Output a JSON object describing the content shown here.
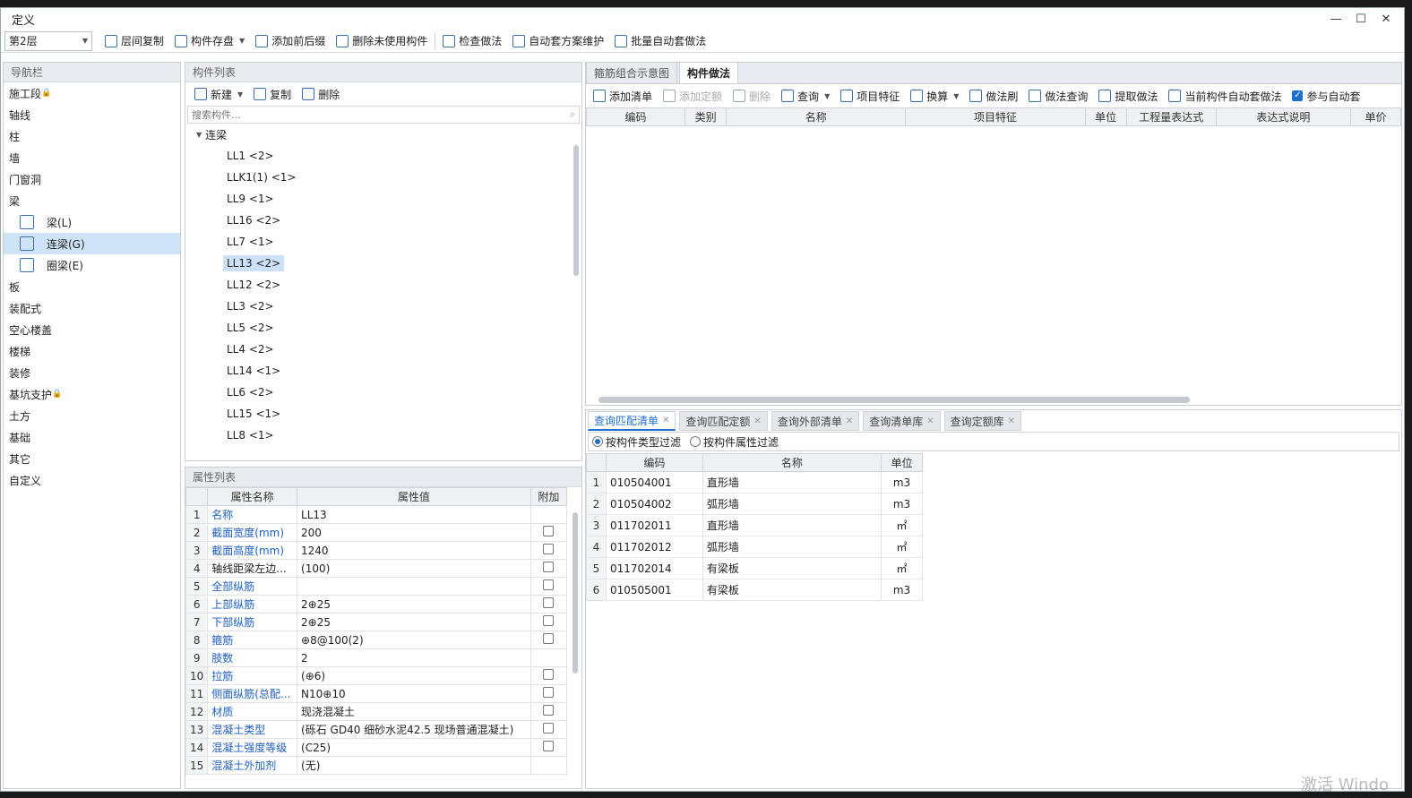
{
  "window": {
    "title": "定义"
  },
  "toolbar": {
    "floor": "第2层",
    "buttons": [
      "层间复制",
      "构件存盘",
      "添加前后缀",
      "删除未使用构件",
      "检查做法",
      "自动套方案维护",
      "批量自动套做法"
    ]
  },
  "nav": {
    "header": "导航栏",
    "items": [
      {
        "label": "施工段",
        "lock": true
      },
      {
        "label": "轴线"
      },
      {
        "label": "柱"
      },
      {
        "label": "墙"
      },
      {
        "label": "门窗洞"
      },
      {
        "label": "梁"
      },
      {
        "label": "梁(L)",
        "sub": true
      },
      {
        "label": "连梁(G)",
        "sub": true,
        "selected": true
      },
      {
        "label": "圈梁(E)",
        "sub": true
      },
      {
        "label": "板"
      },
      {
        "label": "装配式"
      },
      {
        "label": "空心楼盖"
      },
      {
        "label": "楼梯"
      },
      {
        "label": "装修"
      },
      {
        "label": "基坑支护",
        "lock": true
      },
      {
        "label": "土方"
      },
      {
        "label": "基础"
      },
      {
        "label": "其它"
      },
      {
        "label": "自定义"
      }
    ]
  },
  "component_list": {
    "header": "构件列表",
    "actions": [
      "新建",
      "复制",
      "删除"
    ],
    "search_placeholder": "搜索构件...",
    "group": "连梁",
    "items": [
      "LL1 <2>",
      "LLK1(1) <1>",
      "LL9 <1>",
      "LL16 <2>",
      "LL7 <1>",
      "LL13 <2>",
      "LL12 <2>",
      "LL3 <2>",
      "LL5 <2>",
      "LL4 <2>",
      "LL14 <1>",
      "LL6 <2>",
      "LL15 <1>",
      "LL8 <1>"
    ],
    "selected_index": 5
  },
  "properties": {
    "header": "属性列表",
    "columns": [
      "属性名称",
      "属性值",
      "附加"
    ],
    "rows": [
      {
        "n": "1",
        "name": "名称",
        "value": "LL13",
        "blue": true,
        "chk": false
      },
      {
        "n": "2",
        "name": "截面宽度(mm)",
        "value": "200",
        "blue": true,
        "chk": true
      },
      {
        "n": "3",
        "name": "截面高度(mm)",
        "value": "1240",
        "blue": true,
        "chk": true
      },
      {
        "n": "4",
        "name": "轴线距梁左边...",
        "value": "(100)",
        "blue": false,
        "chk": true
      },
      {
        "n": "5",
        "name": "全部纵筋",
        "value": "",
        "blue": true,
        "chk": true
      },
      {
        "n": "6",
        "name": "上部纵筋",
        "value": "2⊕25",
        "blue": true,
        "chk": true
      },
      {
        "n": "7",
        "name": "下部纵筋",
        "value": "2⊕25",
        "blue": true,
        "chk": true
      },
      {
        "n": "8",
        "name": "箍筋",
        "value": "⊕8@100(2)",
        "blue": true,
        "chk": true
      },
      {
        "n": "9",
        "name": "肢数",
        "value": "2",
        "blue": true,
        "chk": false
      },
      {
        "n": "10",
        "name": "拉筋",
        "value": "(⊕6)",
        "blue": true,
        "chk": true
      },
      {
        "n": "11",
        "name": "侧面纵筋(总配...",
        "value": "N10⊕10",
        "blue": true,
        "chk": true
      },
      {
        "n": "12",
        "name": "材质",
        "value": "现浇混凝土",
        "blue": true,
        "chk": true
      },
      {
        "n": "13",
        "name": "混凝土类型",
        "value": "(砾石 GD40 细砂水泥42.5  现场普通混凝土)",
        "blue": true,
        "chk": true
      },
      {
        "n": "14",
        "name": "混凝土强度等级",
        "value": "(C25)",
        "blue": true,
        "chk": true
      },
      {
        "n": "15",
        "name": "混凝土外加剂",
        "value": "(无)",
        "blue": true,
        "chk": false
      }
    ]
  },
  "right": {
    "tabs": [
      "箍筋组合示意图",
      "构件做法"
    ],
    "active_tab": 1,
    "actions": [
      {
        "label": "添加清单",
        "disabled": false
      },
      {
        "label": "添加定额",
        "disabled": true
      },
      {
        "label": "删除",
        "disabled": true
      },
      {
        "label": "查询",
        "disabled": false,
        "caret": true
      },
      {
        "label": "项目特征",
        "disabled": false
      },
      {
        "label": "换算",
        "disabled": false,
        "caret": true
      },
      {
        "label": "做法刷",
        "disabled": false
      },
      {
        "label": "做法查询",
        "disabled": false
      },
      {
        "label": "提取做法",
        "disabled": false
      },
      {
        "label": "当前构件自动套做法",
        "disabled": false
      }
    ],
    "auto_checkbox": "参与自动套",
    "columns": [
      "编码",
      "类别",
      "名称",
      "项目特征",
      "单位",
      "工程量表达式",
      "表达式说明",
      "单价"
    ]
  },
  "query": {
    "tabs": [
      "查询匹配清单",
      "查询匹配定额",
      "查询外部清单",
      "查询清单库",
      "查询定额库"
    ],
    "active_tab": 0,
    "filters": [
      "按构件类型过滤",
      "按构件属性过滤"
    ],
    "columns": [
      "编码",
      "名称",
      "单位"
    ],
    "rows": [
      {
        "n": "1",
        "code": "010504001",
        "name": "直形墙",
        "unit": "m3"
      },
      {
        "n": "2",
        "code": "010504002",
        "name": "弧形墙",
        "unit": "m3"
      },
      {
        "n": "3",
        "code": "011702011",
        "name": "直形墙",
        "unit": "㎡"
      },
      {
        "n": "4",
        "code": "011702012",
        "name": "弧形墙",
        "unit": "㎡"
      },
      {
        "n": "5",
        "code": "011702014",
        "name": "有梁板",
        "unit": "㎡"
      },
      {
        "n": "6",
        "code": "010505001",
        "name": "有梁板",
        "unit": "m3"
      }
    ]
  },
  "watermark": "激活 Windo"
}
